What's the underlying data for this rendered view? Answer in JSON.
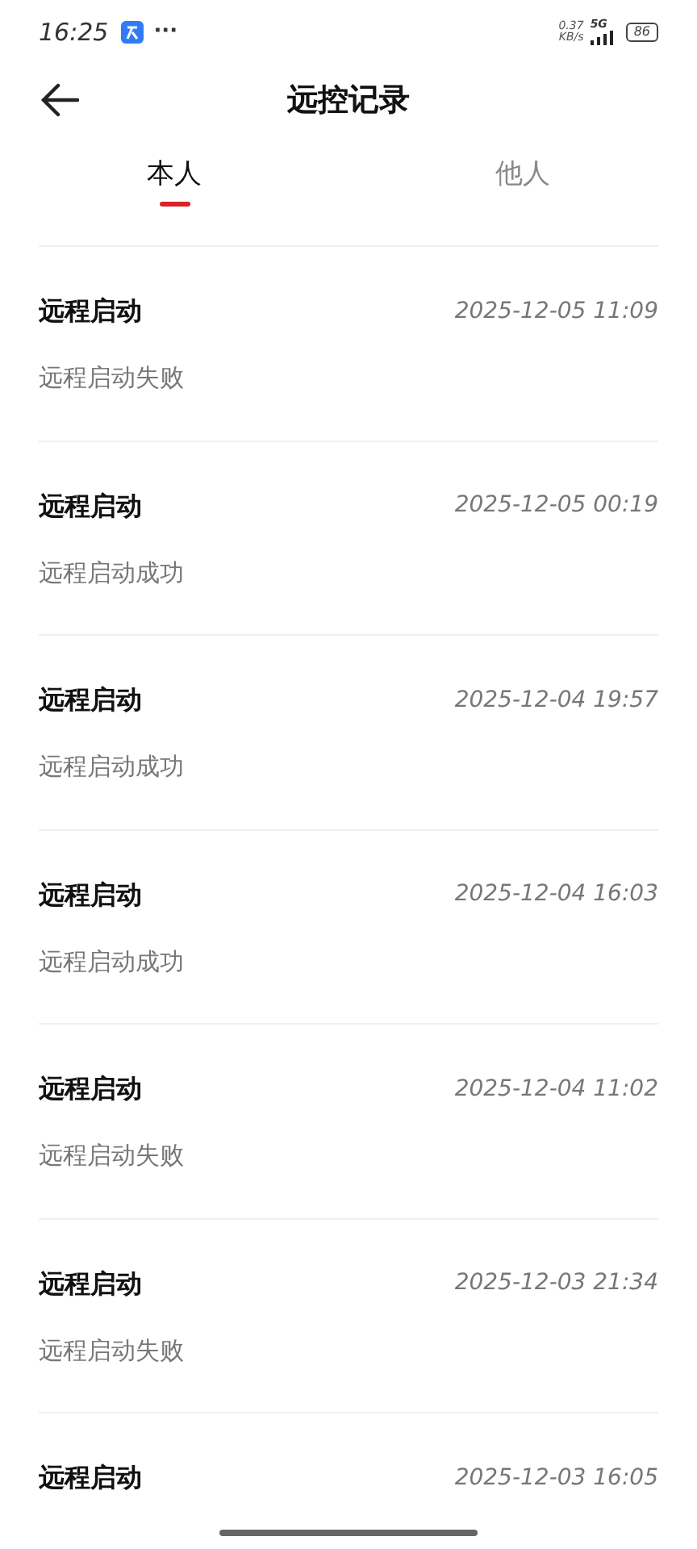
{
  "status_bar": {
    "time": "16:25",
    "more": "···",
    "speed": "0.37",
    "speed_unit": "KB/s",
    "network": "5G",
    "battery": "86"
  },
  "header": {
    "title": "远控记录"
  },
  "tabs": [
    {
      "label": "本人",
      "selected": true
    },
    {
      "label": "他人",
      "selected": false
    }
  ],
  "records": [
    {
      "title": "远程启动",
      "time": "2025-12-05 11:09",
      "result": "远程启动失败"
    },
    {
      "title": "远程启动",
      "time": "2025-12-05 00:19",
      "result": "远程启动成功"
    },
    {
      "title": "远程启动",
      "time": "2025-12-04 19:57",
      "result": "远程启动成功"
    },
    {
      "title": "远程启动",
      "time": "2025-12-04 16:03",
      "result": "远程启动成功"
    },
    {
      "title": "远程启动",
      "time": "2025-12-04 11:02",
      "result": "远程启动失败"
    },
    {
      "title": "远程启动",
      "time": "2025-12-03 21:34",
      "result": "远程启动失败"
    },
    {
      "title": "远程启动",
      "time": "2025-12-03 16:05"
    }
  ]
}
